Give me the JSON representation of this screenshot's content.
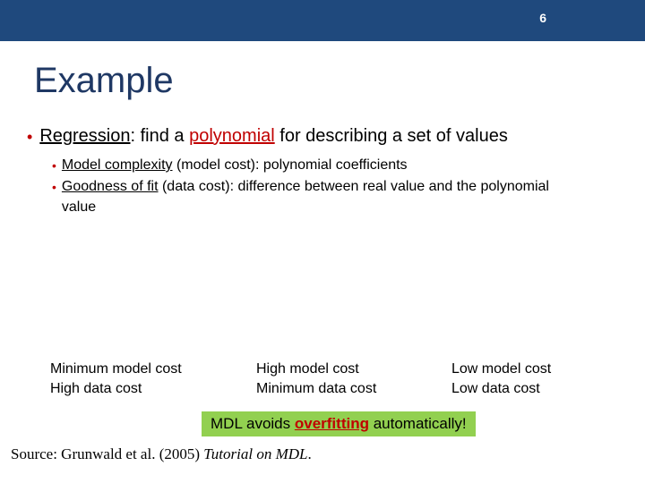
{
  "header": {
    "page_number": "6"
  },
  "title": "Example",
  "main_bullet": {
    "pre": "Regression",
    "mid1": ": find a ",
    "emph": "polynomial",
    "mid2": " for describing a set of values"
  },
  "sub_bullets": [
    {
      "lead": "Model complexity",
      "rest": " (model cost): polynomial coefficients"
    },
    {
      "lead": "Goodness of fit",
      "rest": " (data cost): difference between real value and the polynomial value"
    }
  ],
  "columns": [
    {
      "line1": "Minimum model cost",
      "line2": "High data cost"
    },
    {
      "line1": "High model cost",
      "line2": "Minimum data cost"
    },
    {
      "line1": "Low model cost",
      "line2": "Low data cost"
    }
  ],
  "callout": {
    "pre": "MDL avoids ",
    "emph": "overfitting",
    "post": " automatically!"
  },
  "source": {
    "pre": "Source: Grunwald et al. (2005) ",
    "title": "Tutorial on MDL",
    "post": "."
  }
}
